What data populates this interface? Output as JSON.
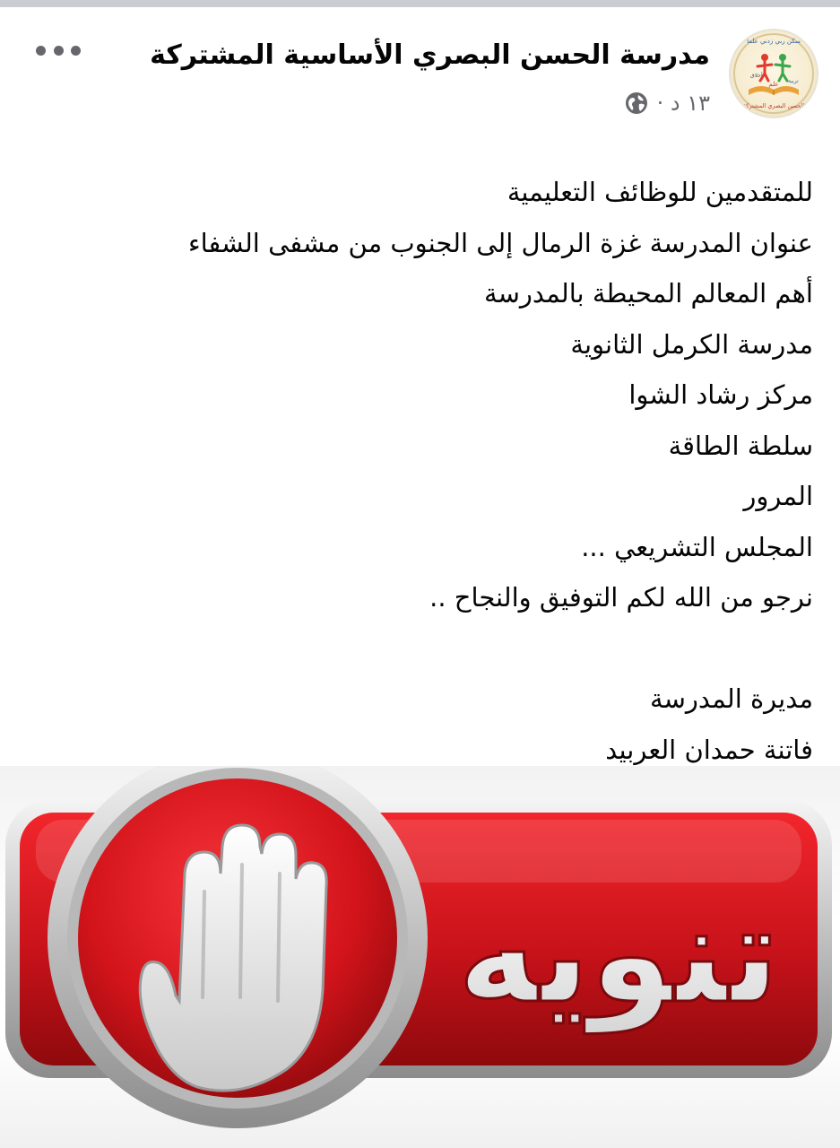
{
  "post": {
    "page_name": "مدرسة الحسن البصري الأساسية المشتركة",
    "time": "١٣ د ·",
    "privacy_icon": "globe-icon",
    "more_icon": "more-options-icon",
    "avatar": {
      "ring_top": "سكن ربي زدني علما",
      "left_word": "أخلاق",
      "center_word": "علم",
      "right_word": "تربية",
      "ring_bottom": "الحسن البصري المشتركة"
    },
    "lines": [
      "للمتقدمين للوظائف التعليمية",
      "عنوان المدرسة غزة الرمال إلى الجنوب من مشفى الشفاء",
      "أهم المعالم المحيطة بالمدرسة",
      "مدرسة الكرمل الثانوية",
      "مركز رشاد الشوا",
      "سلطة الطاقة",
      "المرور",
      "المجلس التشريعي  ...",
      "نرجو من الله لكم التوفيق والنجاح .."
    ],
    "signature": [
      "مديرة المدرسة",
      "فاتنة حمدان العربيد"
    ]
  },
  "attachment": {
    "banner_text": "تنويه",
    "icon": "stop-hand-icon",
    "colors": {
      "red": "#d4141b",
      "dark_red": "#8e0a0d",
      "silver": "#c7c7c7"
    }
  }
}
